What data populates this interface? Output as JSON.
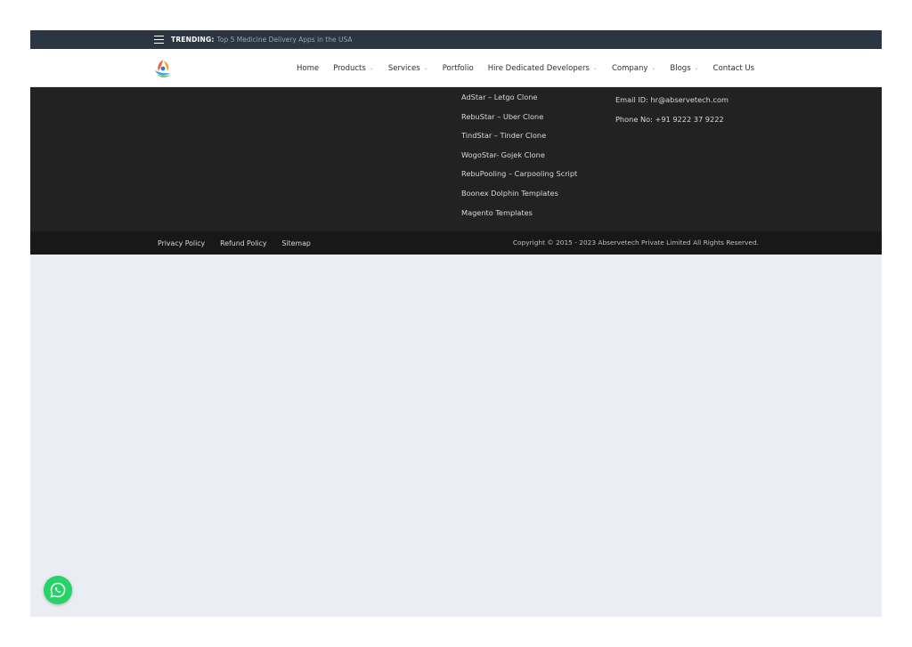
{
  "topbar": {
    "trending_label": "TRENDING:",
    "trending_text": "Top 5 Medicine Delivery Apps in the USA"
  },
  "nav": {
    "items": [
      {
        "label": "Home",
        "dropdown": false
      },
      {
        "label": "Products",
        "dropdown": true
      },
      {
        "label": "Services",
        "dropdown": true
      },
      {
        "label": "Portfolio",
        "dropdown": false
      },
      {
        "label": "Hire Dedicated Developers",
        "dropdown": true
      },
      {
        "label": "Company",
        "dropdown": true
      },
      {
        "label": "Blogs",
        "dropdown": true
      },
      {
        "label": "Contact Us",
        "dropdown": false
      }
    ]
  },
  "footer": {
    "links": [
      "AdStar – Letgo Clone",
      "RebuStar – Uber Clone",
      "TindStar – Tinder Clone",
      "WogoStar- Gojek Clone",
      "RebuPooling – Carpooling Script",
      "Boonex Dolphin Templates",
      "Magento Templates"
    ],
    "email": "Email ID: hr@abservetech.com",
    "phone": "Phone No: +91 9222 37 9222"
  },
  "bottombar": {
    "legal": [
      "Privacy Policy",
      "Refund Policy",
      "Sitemap"
    ],
    "copyright": "Copyright © 2015 - 2023 Abservetech Private Limited All Rights Reserved."
  },
  "colors": {
    "topbar": "#2c3642",
    "footer": "#222222",
    "bottombar": "#181818",
    "page_bg": "#eaedf4",
    "whatsapp": "#25d366"
  }
}
